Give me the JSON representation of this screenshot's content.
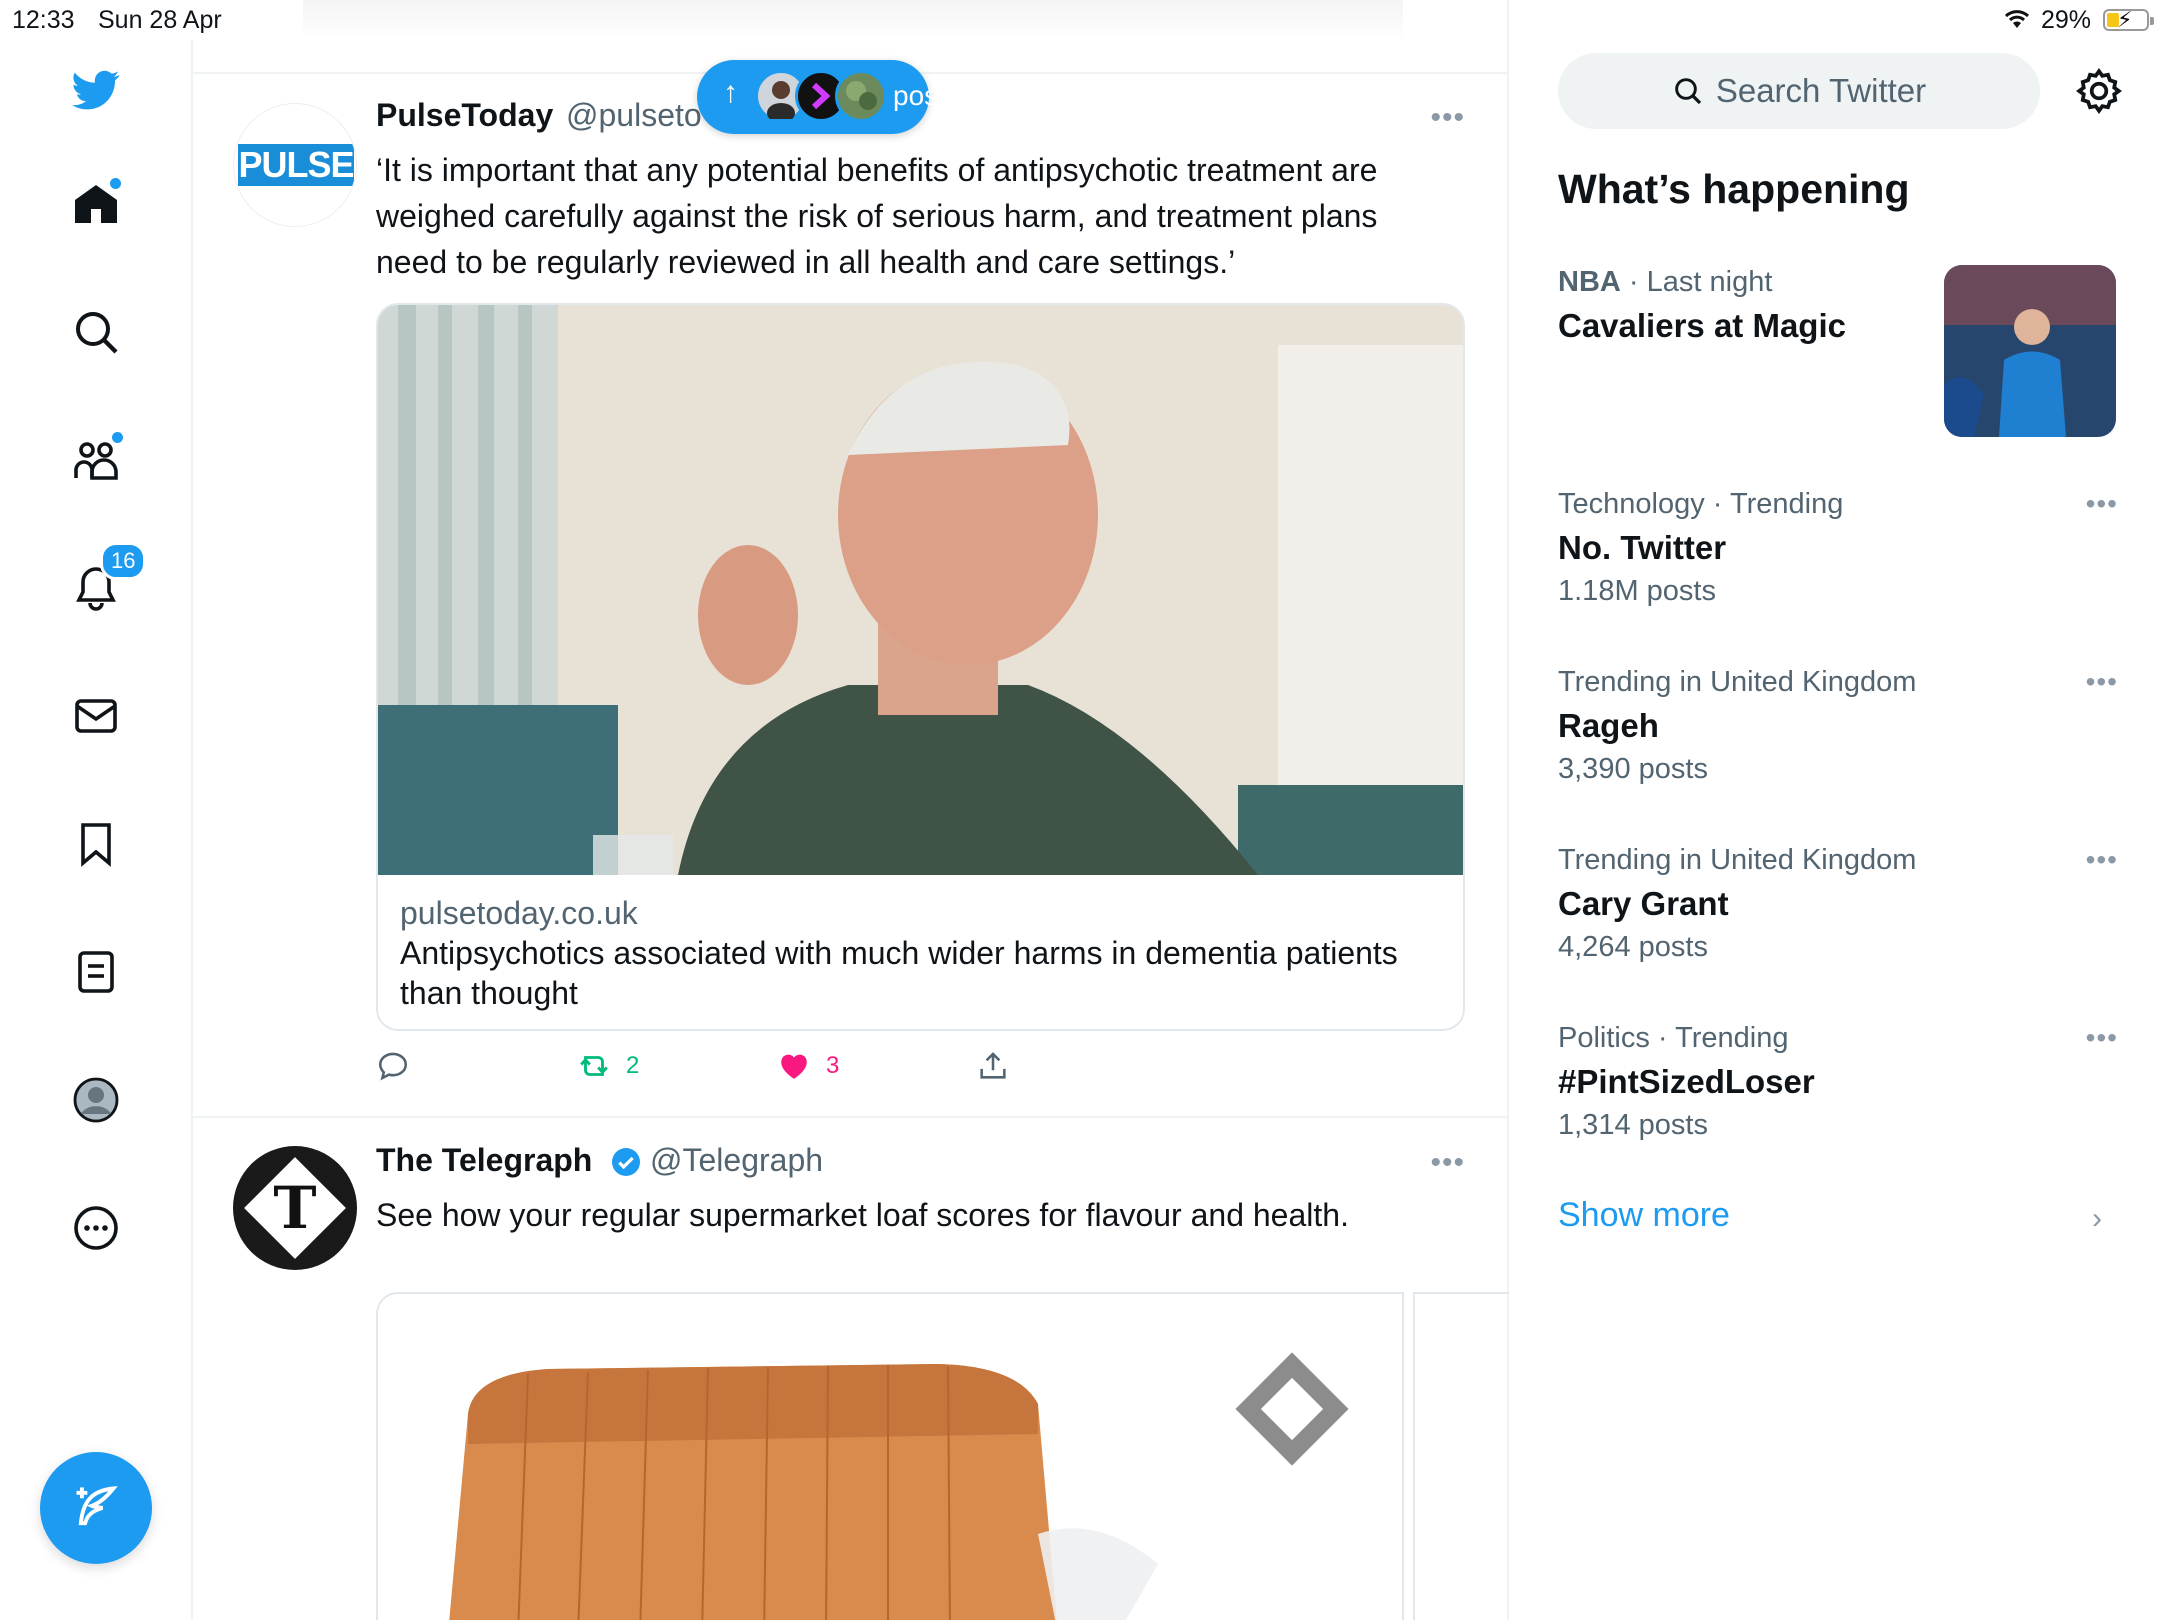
{
  "status_bar": {
    "time": "12:33",
    "date": "Sun 28 Apr",
    "battery_pct": "29%",
    "dots": "•••"
  },
  "nav": {
    "items": [
      "home",
      "explore",
      "communities",
      "notifications",
      "messages",
      "bookmarks",
      "lists",
      "profile",
      "more"
    ],
    "notifications_badge": "16"
  },
  "posted_pill": {
    "arrow": "↑",
    "label": "posted"
  },
  "tweets": [
    {
      "name": "PulseToday",
      "handle": "@pulseto",
      "avatar_text": "PULSE",
      "more": "•••",
      "text": "‘It is important that any potential benefits of antipsychotic treatment are weighed carefully against the risk of serious harm, and treatment plans need to be regularly reviewed in all health and care settings.’",
      "card": {
        "domain": "pulsetoday.co.uk",
        "title": "Antipsychotics associated with much wider harms in dementia patients than thought"
      },
      "retweets": "2",
      "likes": "3"
    },
    {
      "name": "The Telegraph",
      "handle": "@Telegraph",
      "avatar_text": "T",
      "more": "•••",
      "text": "See how your regular supermarket loaf scores for flavour and health."
    }
  ],
  "right": {
    "search_placeholder": "Search Twitter",
    "title": "What’s happening",
    "trends": [
      {
        "category": "NBA",
        "meta": "Last night",
        "name": "Cavaliers at Magic",
        "count": ""
      },
      {
        "category": "Technology · Trending",
        "meta": "",
        "name": "No. Twitter",
        "count": "1.18M posts"
      },
      {
        "category": "Trending in United Kingdom",
        "meta": "",
        "name": "Rageh",
        "count": "3,390 posts"
      },
      {
        "category": "Trending in United Kingdom",
        "meta": "",
        "name": "Cary Grant",
        "count": "4,264 posts"
      },
      {
        "category": "Politics · Trending",
        "meta": "",
        "name": "#PintSizedLoser",
        "count": "1,314 posts"
      }
    ],
    "trend_more": "•••",
    "show_more": "Show more",
    "chevron": "›",
    "dot_sep": "·"
  },
  "colors": {
    "accent": "#1d9bf0",
    "like": "#f91880",
    "retweet": "#00ba7c"
  }
}
